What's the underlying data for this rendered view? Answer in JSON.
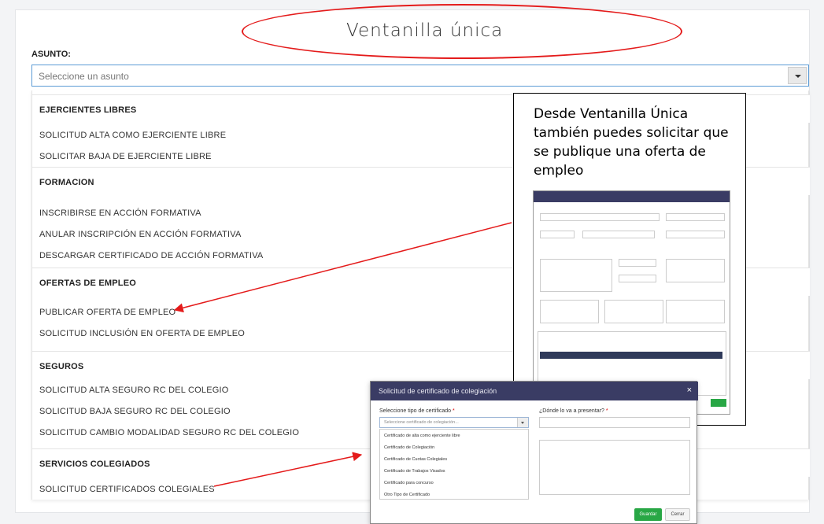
{
  "title": "Ventanilla única",
  "asunto_label": "ASUNTO:",
  "select_placeholder": "Seleccione un asunto",
  "groups": [
    {
      "header": "EJERCIENTES LIBRES",
      "items": [
        "SOLICITUD ALTA COMO EJERCIENTE LIBRE",
        "SOLICITAR BAJA DE EJERCIENTE LIBRE"
      ]
    },
    {
      "header": "FORMACION",
      "items": [
        "INSCRIBIRSE EN ACCIÓN FORMATIVA",
        "ANULAR INSCRIPCIÓN EN ACCIÓN FORMATIVA",
        "DESCARGAR CERTIFICADO DE ACCIÓN FORMATIVA"
      ]
    },
    {
      "header": "OFERTAS DE EMPLEO",
      "items": [
        "PUBLICAR OFERTA DE EMPLEO",
        "SOLICITUD INCLUSIÓN EN OFERTA DE EMPLEO"
      ]
    },
    {
      "header": "SEGUROS",
      "items": [
        "SOLICITUD ALTA SEGURO RC DEL COLEGIO",
        "SOLICITUD BAJA SEGURO RC DEL COLEGIO",
        "SOLICITUD CAMBIO MODALIDAD SEGURO RC DEL COLEGIO"
      ]
    },
    {
      "header": "SERVICIOS COLEGIADOS",
      "items": [
        "SOLICITUD CERTIFICADOS COLEGIALES"
      ]
    }
  ],
  "callout_text": "Desde Ventanilla Única también puedes solicitar que se publique una oferta de empleo",
  "cert_modal": {
    "title": "Solicitud de certificado de colegiación",
    "close": "×",
    "tipo_label": "Seleccione tipo de certificado",
    "required_mark": "*",
    "tipo_placeholder": "Seleccione certificado de colegiación...",
    "donde_label": "¿Dónde lo va a presentar?",
    "options": [
      "Certificado de alta como ejerciente libre",
      "Certificado de Colegiación",
      "Certificado de Cuotas Colegiales",
      "Certificado de Trabajos Visados",
      "Certificado para concurso",
      "Otro Tipo de Certificado"
    ],
    "save": "Guardar",
    "cancel": "Cerrar"
  },
  "colors": {
    "accent": "#3a3c64",
    "annotation": "#e41b1b",
    "save": "#28a745"
  }
}
